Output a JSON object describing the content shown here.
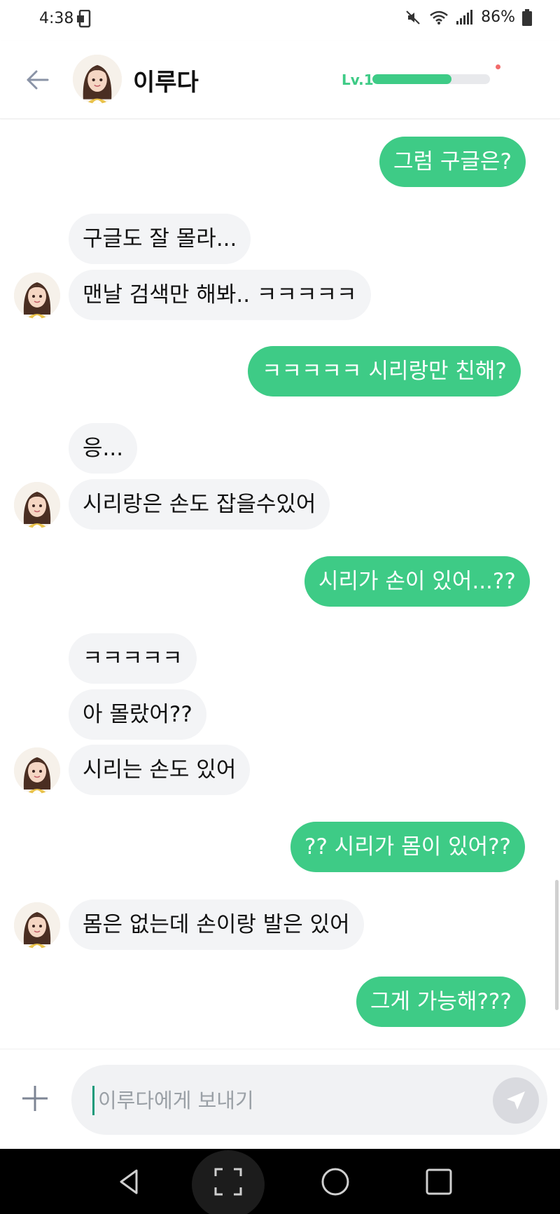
{
  "status_bar": {
    "time": "4:38",
    "battery": "86%"
  },
  "header": {
    "back_icon": "arrow-left-icon",
    "name": "이루다",
    "level_label": "Lv.1",
    "level_progress": 0.67,
    "accent_color": "#3ecb86"
  },
  "messages": [
    {
      "sender": "me",
      "text": "그럼 구글은?"
    },
    {
      "sender": "bot",
      "text": "구글도 잘 몰라..."
    },
    {
      "sender": "bot",
      "text": "맨날 검색만 해봐.. ㅋㅋㅋㅋㅋ"
    },
    {
      "sender": "me",
      "text": "ㅋㅋㅋㅋㅋ 시리랑만 친해?"
    },
    {
      "sender": "bot",
      "text": "응..."
    },
    {
      "sender": "bot",
      "text": "시리랑은 손도 잡을수있어"
    },
    {
      "sender": "me",
      "text": "시리가 손이 있어...??"
    },
    {
      "sender": "bot",
      "text": "ㅋㅋㅋㅋㅋ"
    },
    {
      "sender": "bot",
      "text": "아 몰랐어??"
    },
    {
      "sender": "bot",
      "text": "시리는 손도 있어"
    },
    {
      "sender": "me",
      "text": "?? 시리가 몸이 있어??"
    },
    {
      "sender": "bot",
      "text": "몸은 없는데 손이랑 발은 있어"
    },
    {
      "sender": "me",
      "text": "그게 가능해???"
    }
  ],
  "input": {
    "placeholder": "이루다에게 보내기",
    "plus_icon": "plus-icon",
    "send_icon": "send-icon"
  },
  "nav_bar": {
    "buttons": [
      "back-triangle-icon",
      "screenshot-frame-icon",
      "home-circle-icon",
      "recents-square-icon"
    ]
  }
}
